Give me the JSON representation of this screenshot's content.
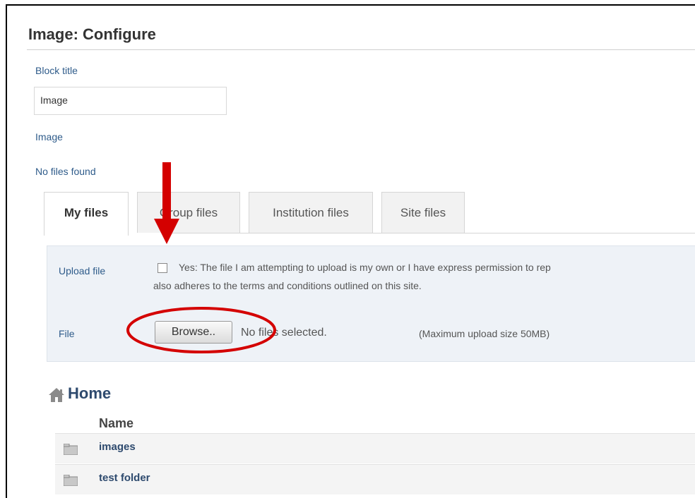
{
  "page": {
    "title": "Image: Configure"
  },
  "form": {
    "block_title_label": "Block title",
    "block_title_value": "Image",
    "image_label": "Image",
    "no_files_found": "No files found"
  },
  "tabs": [
    {
      "label": "My files",
      "active": true
    },
    {
      "label": "Group files",
      "active": false
    },
    {
      "label": "Institution files",
      "active": false
    },
    {
      "label": "Site files",
      "active": false
    }
  ],
  "upload": {
    "upload_label": "Upload file",
    "permission_line1": "Yes: The file I am attempting to upload is my own or I have express permission to rep",
    "permission_line2": "also adheres to the terms and conditions outlined on this site.",
    "file_label": "File",
    "browse_label": "Browse..",
    "no_files_selected": "No files selected.",
    "max_size": "(Maximum upload size 50MB)"
  },
  "browser": {
    "home_label": "Home",
    "column_name": "Name",
    "items": [
      {
        "name": "images",
        "icon": "folder-icon"
      },
      {
        "name": "test folder",
        "icon": "folder-icon"
      }
    ]
  },
  "annotations": {
    "arrow_color": "#d40000",
    "circle_color": "#d40000"
  },
  "colors": {
    "link": "#2e5b8a",
    "panel": "#eef2f7"
  }
}
